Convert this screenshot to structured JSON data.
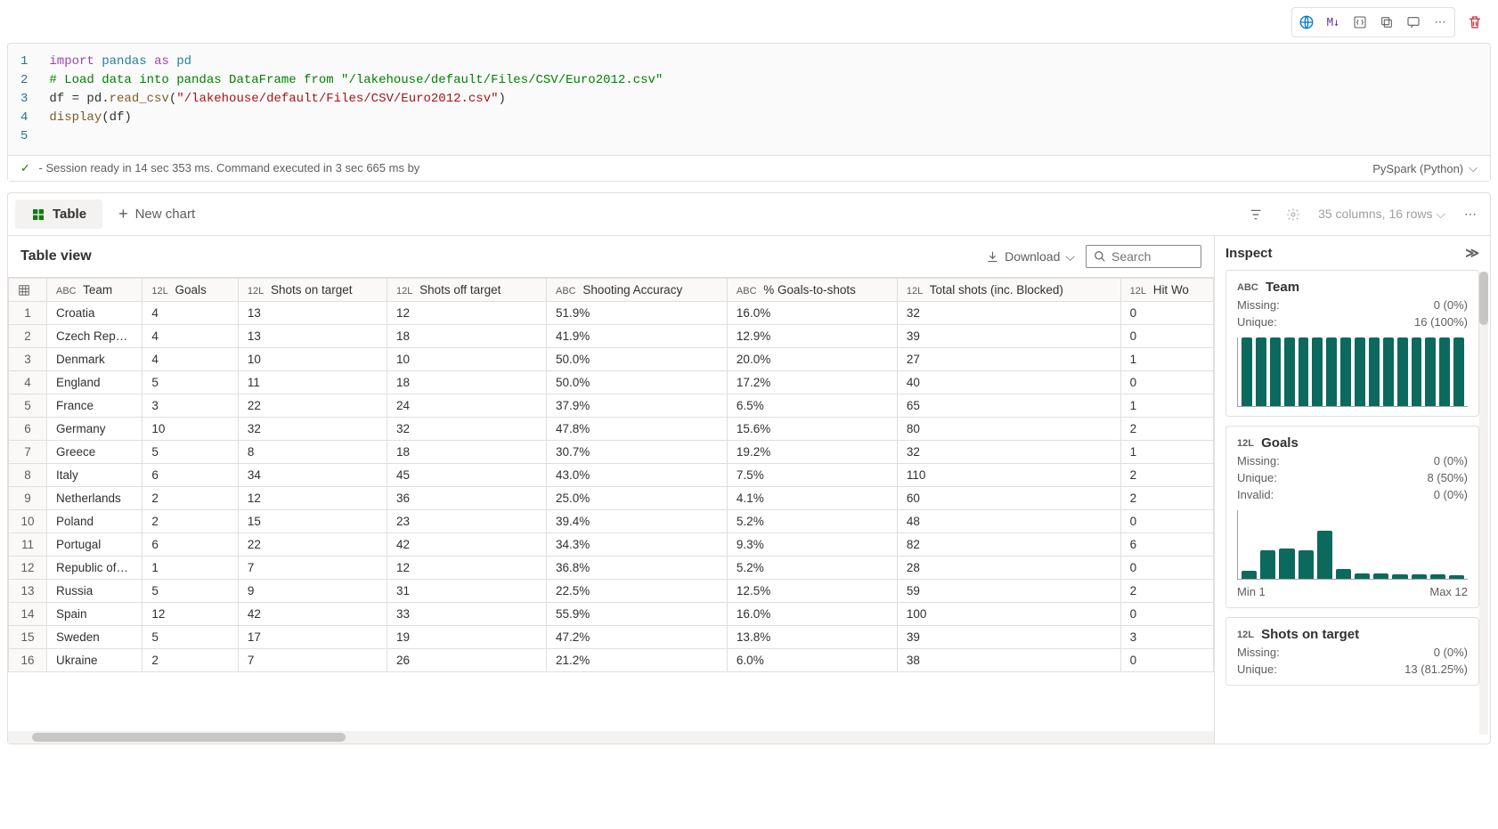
{
  "toolbar": {
    "lang_label": "PySpark (Python)"
  },
  "code": {
    "lines": [
      {
        "n": "1",
        "html": "<span class='kw'>import</span> <span class='cls'>pandas</span> <span class='kw'>as</span> <span class='cls'>pd</span>"
      },
      {
        "n": "2",
        "html": "<span class='comment'># Load data into pandas DataFrame from \"/lakehouse/default/Files/CSV/Euro2012.csv\"</span>"
      },
      {
        "n": "3",
        "html": "df = pd.<span class='fn'>read_csv</span>(<span class='str'>\"/lakehouse/default/Files/CSV/Euro2012.csv\"</span>)"
      },
      {
        "n": "4",
        "html": "<span class='fn'>display</span>(df)"
      },
      {
        "n": "5",
        "html": ""
      }
    ]
  },
  "status": {
    "text": "- Session ready in 14 sec 353 ms. Command executed in 3 sec 665 ms by"
  },
  "outtabs": {
    "table": "Table",
    "newchart": "New chart",
    "columns": "35 columns, 16 rows"
  },
  "tableview": {
    "title": "Table view",
    "download": "Download",
    "search_placeholder": "Search"
  },
  "columns": [
    {
      "type": "ABC",
      "label": "Team",
      "cls": "col-team"
    },
    {
      "type": "12L",
      "label": "Goals",
      "cls": "col-goals"
    },
    {
      "type": "12L",
      "label": "Shots on target",
      "cls": "col-sot"
    },
    {
      "type": "12L",
      "label": "Shots off target",
      "cls": "col-soft"
    },
    {
      "type": "ABC",
      "label": "Shooting Accuracy",
      "cls": "col-sa"
    },
    {
      "type": "ABC",
      "label": "% Goals-to-shots",
      "cls": "col-gts"
    },
    {
      "type": "12L",
      "label": "Total shots (inc. Blocked)",
      "cls": "col-ts"
    },
    {
      "type": "12L",
      "label": "Hit Wo",
      "cls": "col-hw"
    }
  ],
  "rows": [
    [
      "Croatia",
      "4",
      "13",
      "12",
      "51.9%",
      "16.0%",
      "32",
      "0"
    ],
    [
      "Czech Rep…",
      "4",
      "13",
      "18",
      "41.9%",
      "12.9%",
      "39",
      "0"
    ],
    [
      "Denmark",
      "4",
      "10",
      "10",
      "50.0%",
      "20.0%",
      "27",
      "1"
    ],
    [
      "England",
      "5",
      "11",
      "18",
      "50.0%",
      "17.2%",
      "40",
      "0"
    ],
    [
      "France",
      "3",
      "22",
      "24",
      "37.9%",
      "6.5%",
      "65",
      "1"
    ],
    [
      "Germany",
      "10",
      "32",
      "32",
      "47.8%",
      "15.6%",
      "80",
      "2"
    ],
    [
      "Greece",
      "5",
      "8",
      "18",
      "30.7%",
      "19.2%",
      "32",
      "1"
    ],
    [
      "Italy",
      "6",
      "34",
      "45",
      "43.0%",
      "7.5%",
      "110",
      "2"
    ],
    [
      "Netherlands",
      "2",
      "12",
      "36",
      "25.0%",
      "4.1%",
      "60",
      "2"
    ],
    [
      "Poland",
      "2",
      "15",
      "23",
      "39.4%",
      "5.2%",
      "48",
      "0"
    ],
    [
      "Portugal",
      "6",
      "22",
      "42",
      "34.3%",
      "9.3%",
      "82",
      "6"
    ],
    [
      "Republic of…",
      "1",
      "7",
      "12",
      "36.8%",
      "5.2%",
      "28",
      "0"
    ],
    [
      "Russia",
      "5",
      "9",
      "31",
      "22.5%",
      "12.5%",
      "59",
      "2"
    ],
    [
      "Spain",
      "12",
      "42",
      "33",
      "55.9%",
      "16.0%",
      "100",
      "0"
    ],
    [
      "Sweden",
      "5",
      "17",
      "19",
      "47.2%",
      "13.8%",
      "39",
      "3"
    ],
    [
      "Ukraine",
      "2",
      "7",
      "26",
      "21.2%",
      "6.0%",
      "38",
      "0"
    ]
  ],
  "inspect": {
    "title": "Inspect",
    "cards": [
      {
        "type": "ABC",
        "name": "Team",
        "stats": [
          {
            "k": "Missing:",
            "v": "0 (0%)"
          },
          {
            "k": "Unique:",
            "v": "16 (100%)"
          }
        ],
        "bars": [
          100,
          100,
          100,
          100,
          100,
          100,
          100,
          100,
          100,
          100,
          100,
          100,
          100,
          100,
          100,
          100
        ]
      },
      {
        "type": "12L",
        "name": "Goals",
        "stats": [
          {
            "k": "Missing:",
            "v": "0 (0%)"
          },
          {
            "k": "Unique:",
            "v": "8 (50%)"
          },
          {
            "k": "Invalid:",
            "v": "0 (0%)"
          }
        ],
        "bars": [
          12,
          42,
          44,
          42,
          70,
          14,
          8,
          8,
          6,
          6,
          6,
          5
        ],
        "range": {
          "min": "Min 1",
          "max": "Max 12"
        }
      },
      {
        "type": "12L",
        "name": "Shots on target",
        "stats": [
          {
            "k": "Missing:",
            "v": "0 (0%)"
          },
          {
            "k": "Unique:",
            "v": "13 (81.25%)"
          }
        ]
      }
    ]
  },
  "chart_data": {
    "type": "table",
    "title": "Euro 2012 teams",
    "columns": [
      "Team",
      "Goals",
      "Shots on target",
      "Shots off target",
      "Shooting Accuracy",
      "% Goals-to-shots",
      "Total shots (inc. Blocked)",
      "Hit Woodwork"
    ],
    "rows": [
      [
        "Croatia",
        4,
        13,
        12,
        "51.9%",
        "16.0%",
        32,
        0
      ],
      [
        "Czech Republic",
        4,
        13,
        18,
        "41.9%",
        "12.9%",
        39,
        0
      ],
      [
        "Denmark",
        4,
        10,
        10,
        "50.0%",
        "20.0%",
        27,
        1
      ],
      [
        "England",
        5,
        11,
        18,
        "50.0%",
        "17.2%",
        40,
        0
      ],
      [
        "France",
        3,
        22,
        24,
        "37.9%",
        "6.5%",
        65,
        1
      ],
      [
        "Germany",
        10,
        32,
        32,
        "47.8%",
        "15.6%",
        80,
        2
      ],
      [
        "Greece",
        5,
        8,
        18,
        "30.7%",
        "19.2%",
        32,
        1
      ],
      [
        "Italy",
        6,
        34,
        45,
        "43.0%",
        "7.5%",
        110,
        2
      ],
      [
        "Netherlands",
        2,
        12,
        36,
        "25.0%",
        "4.1%",
        60,
        2
      ],
      [
        "Poland",
        2,
        15,
        23,
        "39.4%",
        "5.2%",
        48,
        0
      ],
      [
        "Portugal",
        6,
        22,
        42,
        "34.3%",
        "9.3%",
        82,
        6
      ],
      [
        "Republic of Ireland",
        1,
        7,
        12,
        "36.8%",
        "5.2%",
        28,
        0
      ],
      [
        "Russia",
        5,
        9,
        31,
        "22.5%",
        "12.5%",
        59,
        2
      ],
      [
        "Spain",
        12,
        42,
        33,
        "55.9%",
        "16.0%",
        100,
        0
      ],
      [
        "Sweden",
        5,
        17,
        19,
        "47.2%",
        "13.8%",
        39,
        3
      ],
      [
        "Ukraine",
        2,
        7,
        26,
        "21.2%",
        "6.0%",
        38,
        0
      ]
    ]
  }
}
